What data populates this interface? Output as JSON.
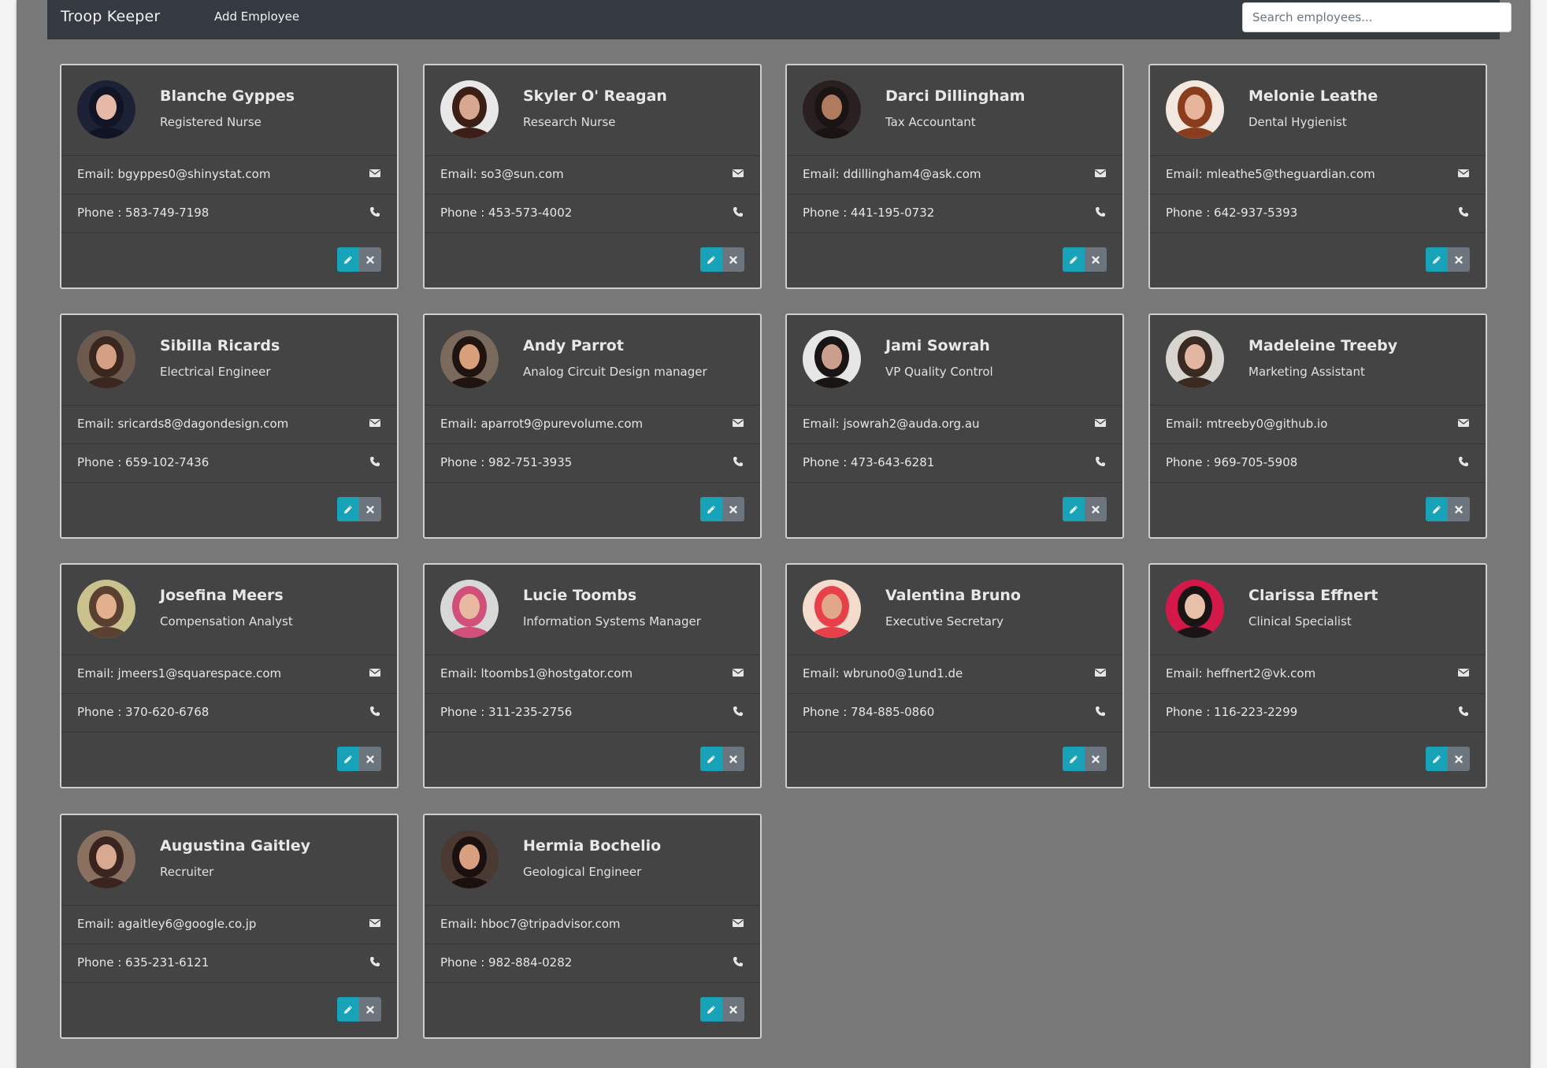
{
  "navbar": {
    "brand": "Troop Keeper",
    "add_link": "Add Employee",
    "search_placeholder": "Search employees...",
    "search_value": ""
  },
  "labels": {
    "email_prefix": "Email: ",
    "phone_prefix": "Phone : "
  },
  "icons": {
    "email": "envelope-icon",
    "phone": "phone-icon",
    "edit": "pencil-icon",
    "delete": "close-icon"
  },
  "colors": {
    "navbar_bg": "#343a40",
    "page_bg": "#787878",
    "card_bg": "#444444",
    "edit_button": "#17a2b8",
    "delete_button": "#6c757d"
  },
  "employees": [
    {
      "name": "Blanche Gyppes",
      "title": "Registered Nurse",
      "email": "bgyppes0@shinystat.com",
      "phone": "583-749-7198",
      "avatar_palette": [
        "#1c2135",
        "#e6b9a6",
        "#101424"
      ]
    },
    {
      "name": "Skyler O' Reagan",
      "title": "Research Nurse",
      "email": "so3@sun.com",
      "phone": "453-573-4002",
      "avatar_palette": [
        "#e8e8e8",
        "#d7a78f",
        "#3b1f16"
      ]
    },
    {
      "name": "Darci Dillingham",
      "title": "Tax Accountant",
      "email": "ddillingham4@ask.com",
      "phone": "441-195-0732",
      "avatar_palette": [
        "#2a2020",
        "#b07a5e",
        "#1a1414"
      ]
    },
    {
      "name": "Melonie Leathe",
      "title": "Dental Hygienist",
      "email": "mleathe5@theguardian.com",
      "phone": "642-937-5393",
      "avatar_palette": [
        "#f2e8e0",
        "#e5b499",
        "#8a3d1c"
      ]
    },
    {
      "name": "Sibilla Ricards",
      "title": "Electrical Engineer",
      "email": "sricards8@dagondesign.com",
      "phone": "659-102-7436",
      "avatar_palette": [
        "#6d5a4e",
        "#d49f82",
        "#3a2820"
      ]
    },
    {
      "name": "Andy Parrot",
      "title": "Analog Circuit Design manager",
      "email": "aparrot9@purevolume.com",
      "phone": "982-751-3935",
      "avatar_palette": [
        "#7a6a5e",
        "#d8a07a",
        "#1f1410"
      ]
    },
    {
      "name": "Jami Sowrah",
      "title": "VP Quality Control",
      "email": "jsowrah2@auda.org.au",
      "phone": "473-643-6281",
      "avatar_palette": [
        "#e6e6e6",
        "#caa08c",
        "#1a1414"
      ]
    },
    {
      "name": "Madeleine Treeby",
      "title": "Marketing Assistant",
      "email": "mtreeby0@github.io",
      "phone": "969-705-5908",
      "avatar_palette": [
        "#d8d4d0",
        "#e2b6a0",
        "#3a2a22"
      ]
    },
    {
      "name": "Josefina Meers",
      "title": "Compensation Analyst",
      "email": "jmeers1@squarespace.com",
      "phone": "370-620-6768",
      "avatar_palette": [
        "#c9c28c",
        "#e2b08c",
        "#5a4030"
      ]
    },
    {
      "name": "Lucie Toombs",
      "title": "Information Systems Manager",
      "email": "ltoombs1@hostgator.com",
      "phone": "311-235-2756",
      "avatar_palette": [
        "#d8d8d8",
        "#e8b8a0",
        "#d0507a"
      ]
    },
    {
      "name": "Valentina Bruno",
      "title": "Executive Secretary",
      "email": "wbruno0@1und1.de",
      "phone": "784-885-0860",
      "avatar_palette": [
        "#f4dccc",
        "#e0a888",
        "#e8404a"
      ]
    },
    {
      "name": "Clarissa Effnert",
      "title": "Clinical Specialist",
      "email": "heffnert2@vk.com",
      "phone": "116-223-2299",
      "avatar_palette": [
        "#d4184a",
        "#e8c0a8",
        "#1a1414"
      ]
    },
    {
      "name": "Augustina Gaitley",
      "title": "Recruiter",
      "email": "agaitley6@google.co.jp",
      "phone": "635-231-6121",
      "avatar_palette": [
        "#8a7060",
        "#d8a890",
        "#3a2420"
      ]
    },
    {
      "name": "Hermia Bochelio",
      "title": "Geological Engineer",
      "email": "hboc7@tripadvisor.com",
      "phone": "982-884-0282",
      "avatar_palette": [
        "#4a3a32",
        "#d8a080",
        "#1a1010"
      ]
    }
  ]
}
